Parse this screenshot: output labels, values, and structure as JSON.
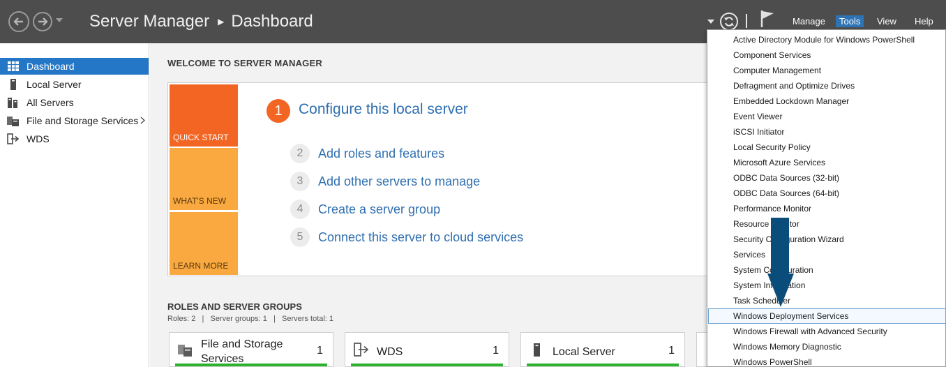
{
  "header": {
    "app_title": "Server Manager",
    "page_title": "Dashboard",
    "menus": [
      "Manage",
      "Tools",
      "View",
      "Help"
    ]
  },
  "sidebar": {
    "items": [
      {
        "label": "Dashboard",
        "icon": "dashboard-grid-icon",
        "selected": true
      },
      {
        "label": "Local Server",
        "icon": "server-icon"
      },
      {
        "label": "All Servers",
        "icon": "servers-icon"
      },
      {
        "label": "File and Storage Services",
        "icon": "storage-icon",
        "has_submenu": true
      },
      {
        "label": "WDS",
        "icon": "wds-icon"
      }
    ]
  },
  "welcome": {
    "heading": "WELCOME TO SERVER MANAGER",
    "tiles": [
      "QUICK START",
      "WHAT'S NEW",
      "LEARN MORE"
    ],
    "main_step": {
      "number": "1",
      "label": "Configure this local server"
    },
    "steps": [
      {
        "number": "2",
        "label": "Add roles and features"
      },
      {
        "number": "3",
        "label": "Add other servers to manage"
      },
      {
        "number": "4",
        "label": "Create a server group"
      },
      {
        "number": "5",
        "label": "Connect this server to cloud services"
      }
    ]
  },
  "roles": {
    "heading": "ROLES AND SERVER GROUPS",
    "summary": "Roles: 2   |   Server groups: 1   |   Servers total: 1",
    "cards": [
      {
        "name_line1": "File and Storage",
        "name_line2": "Services",
        "count": "1"
      },
      {
        "name_line1": "WDS",
        "name_line2": "",
        "count": "1"
      },
      {
        "name_line1": "Local Server",
        "name_line2": "",
        "count": "1"
      }
    ]
  },
  "tools_menu": {
    "items": [
      "Active Directory Module for Windows PowerShell",
      "Component Services",
      "Computer Management",
      "Defragment and Optimize Drives",
      "Embedded Lockdown Manager",
      "Event Viewer",
      "iSCSI Initiator",
      "Local Security Policy",
      "Microsoft Azure Services",
      "ODBC Data Sources (32-bit)",
      "ODBC Data Sources (64-bit)",
      "Performance Monitor",
      "Resource Monitor",
      "Security Configuration Wizard",
      "Services",
      "System Configuration",
      "System Information",
      "Task Scheduler",
      "Windows Deployment Services",
      "Windows Firewall with Advanced Security",
      "Windows Memory Diagnostic",
      "Windows PowerShell"
    ],
    "highlighted": "Windows Deployment Services"
  },
  "colors": {
    "header_bg": "#4d4d4d",
    "accent_blue": "#2477c6",
    "quick_start_orange": "#f26522",
    "tile_amber": "#f9a93f",
    "link_blue": "#2f6fb0",
    "status_green": "#2db22d",
    "annotation_arrow": "#0b4d7a"
  }
}
